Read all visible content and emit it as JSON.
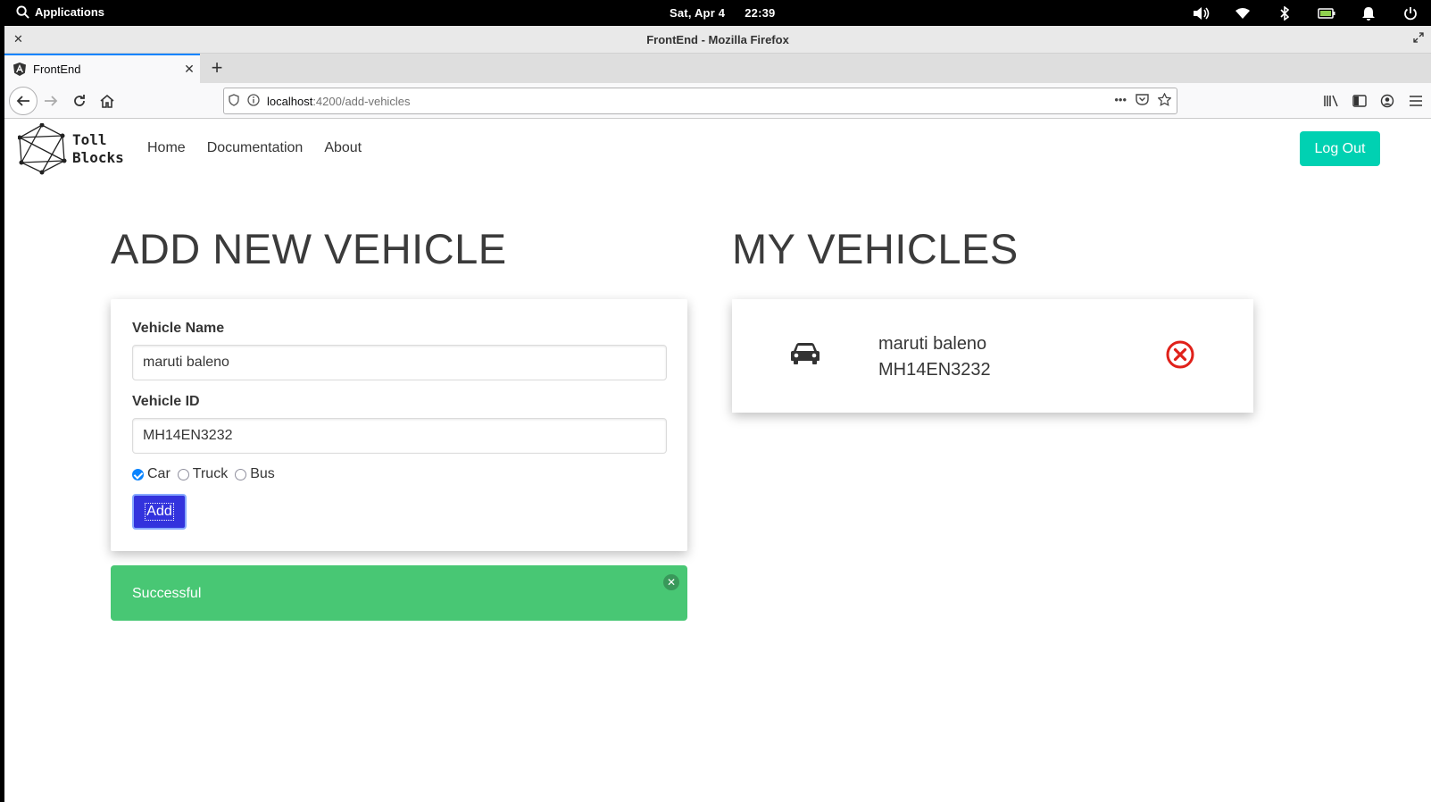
{
  "system": {
    "apps_label": "Applications",
    "date": "Sat, Apr 4",
    "time": "22:39"
  },
  "browser": {
    "window_title": "FrontEnd - Mozilla Firefox",
    "tab_title": "FrontEnd",
    "url_host": "localhost",
    "url_path": ":4200/add-vehicles"
  },
  "nav": {
    "brand_line1": "Toll",
    "brand_line2": "Blocks",
    "home": "Home",
    "documentation": "Documentation",
    "about": "About",
    "logout": "Log Out"
  },
  "add_form": {
    "heading": "ADD NEW VEHICLE",
    "name_label": "Vehicle Name",
    "name_value": "maruti baleno",
    "id_label": "Vehicle ID",
    "id_value": "MH14EN3232",
    "types": [
      "Car",
      "Truck",
      "Bus"
    ],
    "selected_type": "Car",
    "add_label": "Add",
    "notification": "Successful"
  },
  "my_vehicles": {
    "heading": "MY VEHICLES",
    "items": [
      {
        "name": "maruti baleno",
        "id": "MH14EN3232"
      }
    ]
  },
  "colors": {
    "accent": "#00d1b2",
    "success": "#48c774",
    "add_button": "#3333dd",
    "remove": "#e0211a"
  }
}
